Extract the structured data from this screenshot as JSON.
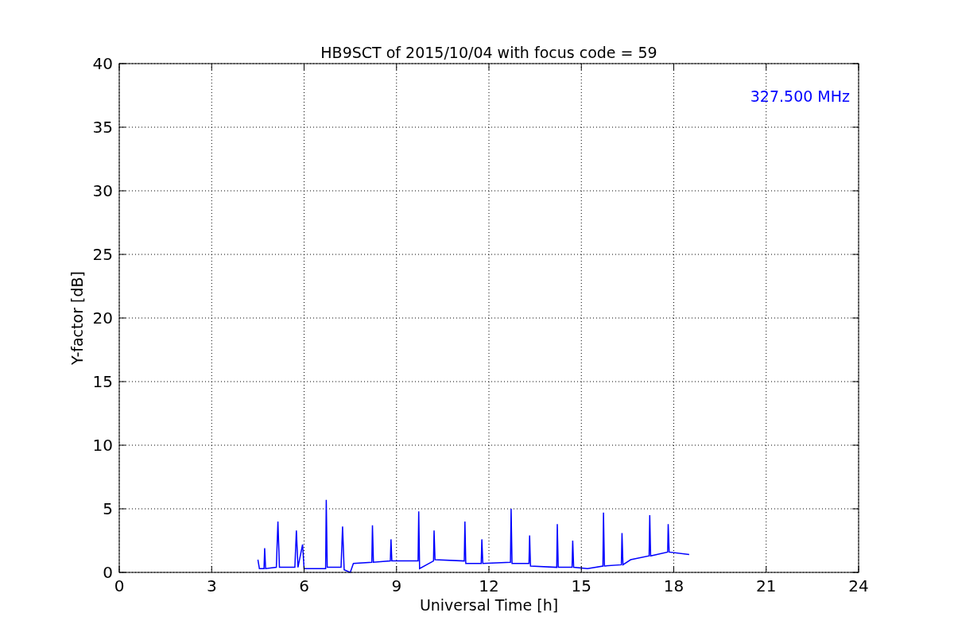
{
  "chart_data": {
    "type": "line",
    "title": "HB9SCT of 2015/10/04 with focus code = 59",
    "xlabel": "Universal Time [h]",
    "ylabel": "Y-factor [dB]",
    "xlim": [
      0,
      24
    ],
    "ylim": [
      0,
      40
    ],
    "xticks": [
      0,
      3,
      6,
      9,
      12,
      15,
      18,
      21,
      24
    ],
    "yticks": [
      0,
      5,
      10,
      15,
      20,
      25,
      30,
      35,
      40
    ],
    "x": [
      4.5,
      4.55,
      4.7,
      4.72,
      4.75,
      5.1,
      5.15,
      5.2,
      5.7,
      5.75,
      5.8,
      5.95,
      6.0,
      6.7,
      6.72,
      6.75,
      7.2,
      7.25,
      7.3,
      7.5,
      7.6,
      8.2,
      8.22,
      8.25,
      8.8,
      8.82,
      8.85,
      9.7,
      9.72,
      9.75,
      10.2,
      10.22,
      10.25,
      11.2,
      11.22,
      11.25,
      11.75,
      11.77,
      11.8,
      12.7,
      12.72,
      12.75,
      13.3,
      13.32,
      13.35,
      14.2,
      14.22,
      14.25,
      14.7,
      14.72,
      14.75,
      15.2,
      15.7,
      15.72,
      15.75,
      16.3,
      16.32,
      16.35,
      16.6,
      17.2,
      17.22,
      17.25,
      17.8,
      17.82,
      17.85,
      18.5
    ],
    "series": [
      {
        "name": "327.500 MHz",
        "color": "#0000ff",
        "values": [
          1.0,
          0.3,
          0.3,
          1.9,
          0.3,
          0.4,
          4.0,
          0.4,
          0.4,
          3.3,
          0.4,
          2.2,
          0.3,
          0.3,
          5.7,
          0.4,
          0.4,
          3.6,
          0.2,
          0.0,
          0.7,
          0.8,
          3.7,
          0.8,
          0.9,
          2.6,
          0.9,
          0.9,
          4.8,
          0.3,
          0.9,
          3.3,
          1.0,
          0.9,
          4.0,
          0.7,
          0.7,
          2.6,
          0.7,
          0.8,
          5.0,
          0.7,
          0.7,
          2.9,
          0.5,
          0.4,
          3.8,
          0.4,
          0.4,
          2.5,
          0.4,
          0.3,
          0.5,
          4.7,
          0.5,
          0.6,
          3.1,
          0.6,
          1.0,
          1.3,
          4.5,
          1.3,
          1.6,
          3.8,
          1.6,
          1.4
        ]
      }
    ],
    "grid": true
  }
}
